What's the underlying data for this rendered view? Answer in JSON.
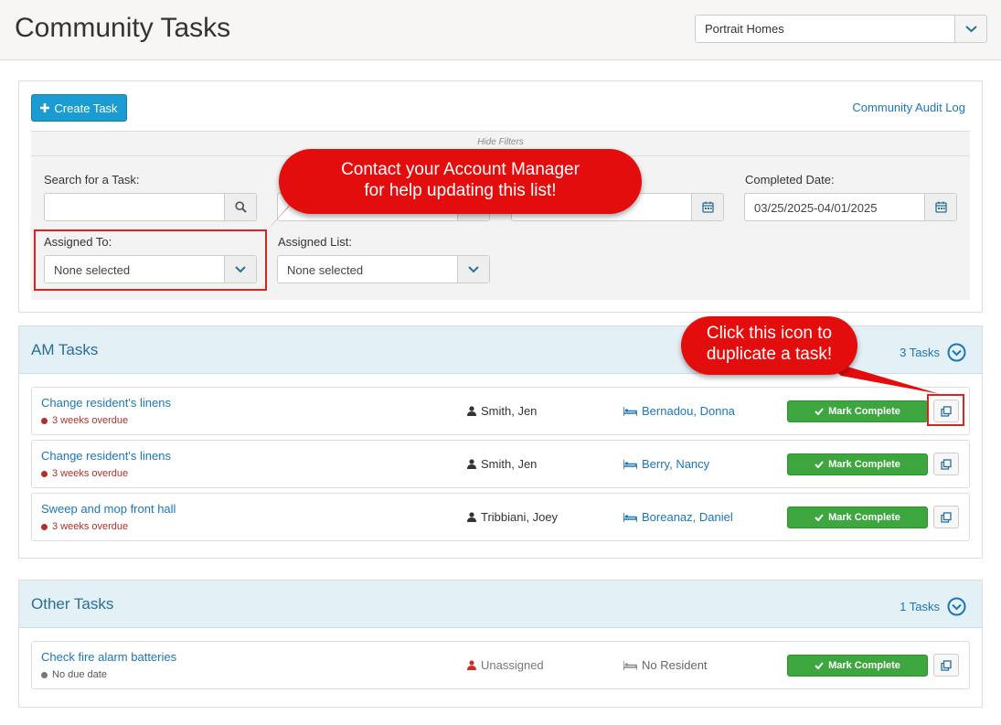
{
  "header": {
    "title": "Community Tasks",
    "community": "Portrait Homes"
  },
  "toolbar": {
    "create_label": "Create Task",
    "audit_log_label": "Community Audit Log"
  },
  "filters": {
    "hide_label": "Hide Filters",
    "search_label": "Search for a Task:",
    "search_value": "",
    "completed_date_label": "Completed Date:",
    "completed_date_value": "03/25/2025-04/01/2025",
    "assigned_to_label": "Assigned To:",
    "assigned_to_value": "None selected",
    "assigned_list_label": "Assigned List:",
    "assigned_list_value": "None selected"
  },
  "callouts": {
    "account_manager": [
      "Contact your Account Manager",
      "for help updating this list!"
    ],
    "duplicate": [
      "Click this icon to",
      "duplicate a task!"
    ]
  },
  "sections": [
    {
      "title": "AM Tasks",
      "count": "3 Tasks",
      "tasks": [
        {
          "name": "Change resident's linens",
          "due": "3 weeks overdue",
          "assignee": "Smith, Jen",
          "resident": "Bernadou, Donna",
          "action": "Mark Complete"
        },
        {
          "name": "Change resident's linens",
          "due": "3 weeks overdue",
          "assignee": "Smith, Jen",
          "resident": "Berry, Nancy",
          "action": "Mark Complete"
        },
        {
          "name": "Sweep and mop front hall",
          "due": "3 weeks overdue",
          "assignee": "Tribbiani, Joey",
          "resident": "Boreanaz, Daniel",
          "action": "Mark Complete"
        }
      ]
    },
    {
      "title": "Other Tasks",
      "count": "1 Tasks",
      "tasks": [
        {
          "name": "Check fire alarm batteries",
          "due": "No due date",
          "assignee": "Unassigned",
          "resident": "No Resident",
          "action": "Mark Complete"
        }
      ]
    }
  ],
  "colors": {
    "accent": "#1a9bd1",
    "success": "#3ea63e",
    "callout": "#e30d0d",
    "overdue": "#b0302a"
  }
}
